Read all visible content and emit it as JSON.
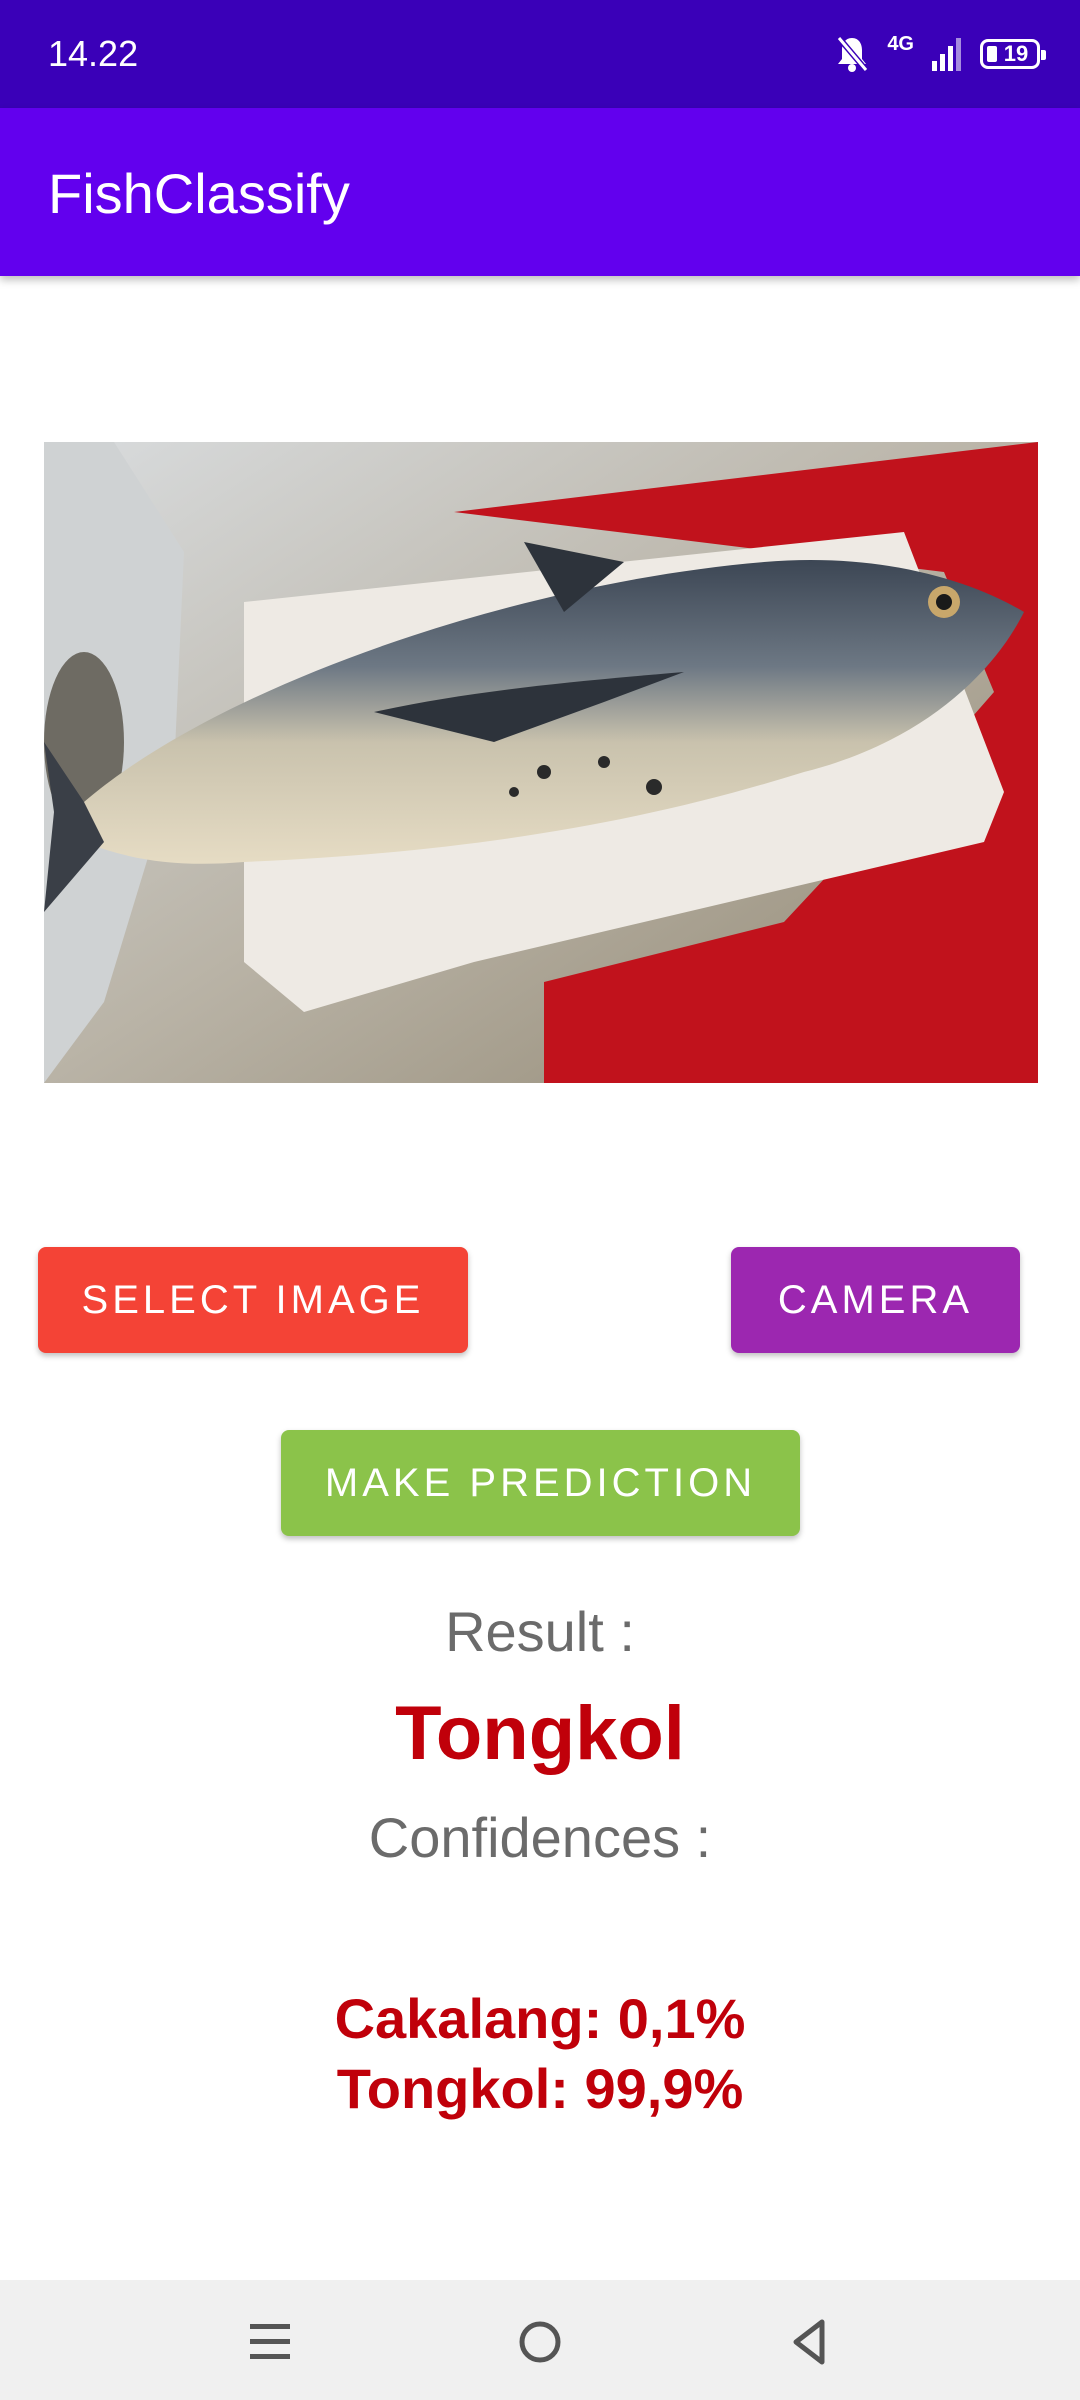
{
  "status_bar": {
    "time": "14.22",
    "network_label": "4G",
    "battery_level": "19",
    "icons": [
      "bell-muted-icon",
      "signal-icon",
      "battery-icon"
    ]
  },
  "app_bar": {
    "title": "FishClassify",
    "color": "#6200ee"
  },
  "main": {
    "image": {
      "subject": "fish-photo"
    },
    "buttons": {
      "select_image": "SELECT IMAGE",
      "camera": "CAMERA",
      "make_prediction": "MAKE PREDICTION"
    },
    "result_label": "Result :",
    "result_value": "Tongkol",
    "confidences_label": "Confidences :",
    "confidences": [
      "Cakalang: 0,1%",
      "Tongkol: 99,9%"
    ]
  },
  "nav_bar": {
    "icons": [
      "menu-icon",
      "home-icon",
      "back-icon"
    ]
  },
  "colors": {
    "status_bar": "#3a00b8",
    "select_button": "#f44336",
    "camera_button": "#9c27b0",
    "predict_button": "#8bc34a",
    "result_text": "#c0000a",
    "label_text": "#6b6b6b"
  }
}
